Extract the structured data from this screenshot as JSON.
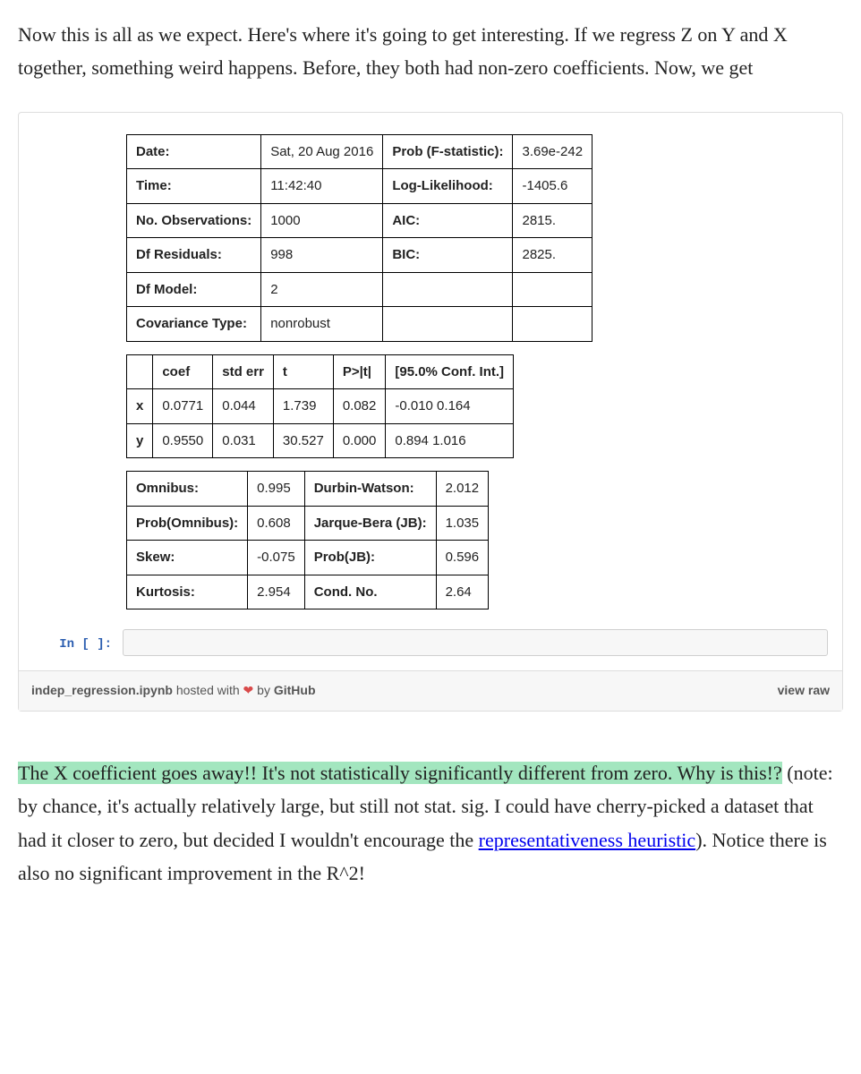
{
  "prose": {
    "p1": "Now this is all as we expect. Here's where it's going to get interesting. If we regress Z on Y and X together, something weird happens. Before, they both had non-zero coefficients. Now, we get",
    "p2_hl": "The X coefficient goes away!! It's not statistically significantly different from zero. Why is this!?",
    "p2_tail_a": " (note: by chance, it's actually relatively large, but still not stat. sig. I could have cherry-picked a dataset that had it closer to zero, but decided I wouldn't encourage the ",
    "p2_link": "representativeness heuristic",
    "p2_tail_b": "). Notice there is also no significant improvement in the R^2!"
  },
  "summary_rows": [
    {
      "l": "Date:",
      "lv": "Sat, 20 Aug 2016",
      "r": "Prob (F-statistic):",
      "rv": "3.69e-242"
    },
    {
      "l": "Time:",
      "lv": "11:42:40",
      "r": "Log-Likelihood:",
      "rv": "-1405.6"
    },
    {
      "l": "No. Observations:",
      "lv": "1000",
      "r": "AIC:",
      "rv": "2815."
    },
    {
      "l": "Df Residuals:",
      "lv": "998",
      "r": "BIC:",
      "rv": "2825."
    },
    {
      "l": "Df Model:",
      "lv": "2",
      "r": "",
      "rv": ""
    },
    {
      "l": "Covariance Type:",
      "lv": "nonrobust",
      "r": "",
      "rv": ""
    }
  ],
  "coef_headers": [
    "",
    "coef",
    "std err",
    "t",
    "P>|t|",
    "[95.0% Conf. Int.]"
  ],
  "coef_rows": [
    {
      "name": "x",
      "coef": "0.0771",
      "se": "0.044",
      "t": "1.739",
      "p": "0.082",
      "ci": "-0.010 0.164"
    },
    {
      "name": "y",
      "coef": "0.9550",
      "se": "0.031",
      "t": "30.527",
      "p": "0.000",
      "ci": "0.894 1.016"
    }
  ],
  "diag_rows": [
    {
      "l": "Omnibus:",
      "lv": "0.995",
      "r": "Durbin-Watson:",
      "rv": "2.012"
    },
    {
      "l": "Prob(Omnibus):",
      "lv": "0.608",
      "r": "Jarque-Bera (JB):",
      "rv": "1.035"
    },
    {
      "l": "Skew:",
      "lv": "-0.075",
      "r": "Prob(JB):",
      "rv": "0.596"
    },
    {
      "l": "Kurtosis:",
      "lv": "2.954",
      "r": "Cond. No.",
      "rv": "2.64"
    }
  ],
  "prompt": "In [ ]:",
  "gist": {
    "filename": "indep_regression.ipynb",
    "hosted": " hosted with ",
    "by": " by ",
    "github": "GitHub",
    "viewraw": "view raw"
  }
}
